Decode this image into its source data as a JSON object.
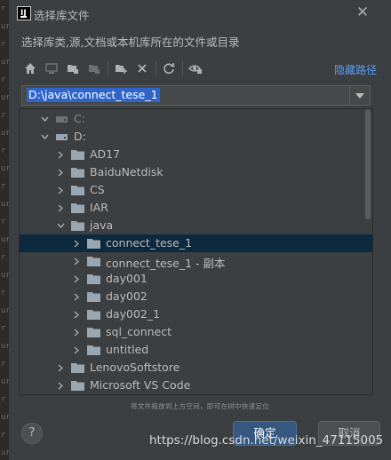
{
  "window": {
    "title": "选择库文件",
    "description": "选择库类,源,文档或本机库所在的文件或目录"
  },
  "toolbar": {
    "hide_path_label": "隐藏路径"
  },
  "path": {
    "value": "D:\\java\\connect_tese_1"
  },
  "tree": {
    "rows": [
      {
        "label": "C:",
        "icon": "drive-icon"
      },
      {
        "label": "D:",
        "icon": "drive-icon"
      },
      {
        "label": "AD17",
        "icon": "folder-icon"
      },
      {
        "label": "BaiduNetdisk",
        "icon": "folder-icon"
      },
      {
        "label": "CS",
        "icon": "folder-icon"
      },
      {
        "label": "IAR",
        "icon": "folder-icon"
      },
      {
        "label": "java",
        "icon": "folder-icon"
      },
      {
        "label": "connect_tese_1",
        "icon": "folder-icon"
      },
      {
        "label": "connect_tese_1 - 副本",
        "icon": "folder-icon"
      },
      {
        "label": "day001",
        "icon": "folder-icon"
      },
      {
        "label": "day002",
        "icon": "folder-icon"
      },
      {
        "label": "day002_1",
        "icon": "folder-icon"
      },
      {
        "label": "sql_connect",
        "icon": "folder-icon"
      },
      {
        "label": "untitled",
        "icon": "folder-icon"
      },
      {
        "label": "LenovoSoftstore",
        "icon": "folder-icon"
      },
      {
        "label": "Microsoft VS Code",
        "icon": "folder-icon"
      },
      {
        "label": "",
        "icon": "folder-icon"
      }
    ]
  },
  "hint": "将文件拖放到上方空间，即可在树中快速定位",
  "footer": {
    "help_label": "?",
    "ok_label": "确定",
    "cancel_label": "取消"
  },
  "watermark": "https://blog.csdn.net/weixin_47115005",
  "colors": {
    "accent": "#2f65ca",
    "selection": "#0d293e",
    "link": "#589df6",
    "folder": "#9aa7b0"
  }
}
